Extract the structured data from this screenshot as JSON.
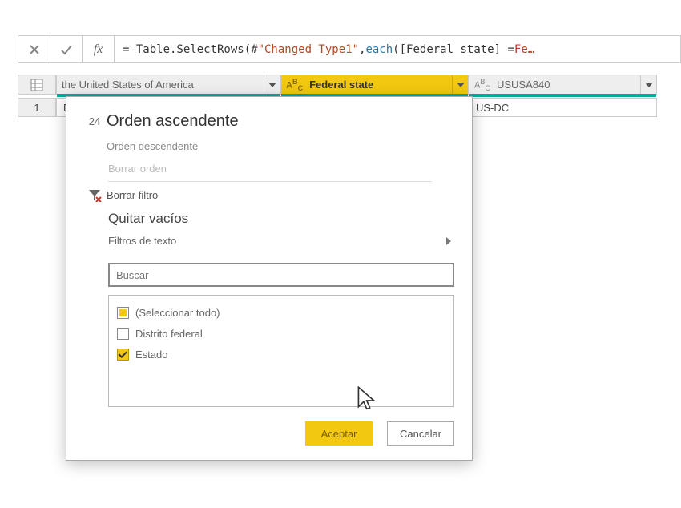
{
  "formula": {
    "prefix": "= Table.SelectRows(#",
    "str": "\"Changed Type1\"",
    "mid": ", ",
    "kw": "each",
    "tail": " ([Federal state] = ",
    "trunc": "Fe…"
  },
  "columns": {
    "c1": "the United States of America",
    "c2": "Federal state",
    "c3": "USUSA840"
  },
  "row1": {
    "num": "1",
    "c1_frag": "D",
    "c3": "US-DC"
  },
  "dropdown": {
    "sort_number_badge": "24",
    "sort_asc": "Orden ascendente",
    "sort_desc": "Orden descendente",
    "clear_sort": "Borrar orden",
    "clear_filter": "Borrar filtro",
    "remove_empty": "Quitar vacíos",
    "text_filters": "Filtros de texto",
    "search_placeholder": "Buscar",
    "items": {
      "select_all": "(Seleccionar todo)",
      "distrito": "Distrito federal",
      "estado": "Estado"
    },
    "ok": "Aceptar",
    "cancel": "Cancelar"
  }
}
